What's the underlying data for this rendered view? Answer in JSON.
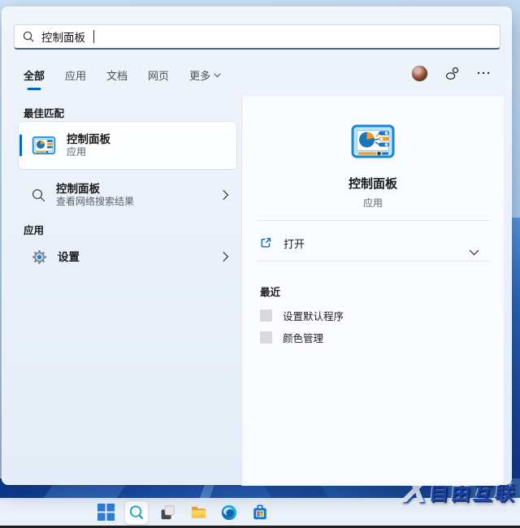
{
  "search": {
    "query": "控制面板"
  },
  "tabs": {
    "items": [
      {
        "label": "全部",
        "active": true
      },
      {
        "label": "应用",
        "active": false
      },
      {
        "label": "文档",
        "active": false
      },
      {
        "label": "网页",
        "active": false
      },
      {
        "label": "更多",
        "active": false,
        "has_chevron": true
      }
    ]
  },
  "header_icons": {
    "more_label": "···"
  },
  "left": {
    "best_match_header": "最佳匹配",
    "best_match": {
      "title": "控制面板",
      "subtitle": "应用"
    },
    "web_suggestion": {
      "title": "控制面板",
      "subtitle": "查看网络搜索结果"
    },
    "apps_header": "应用",
    "settings": {
      "label": "设置"
    }
  },
  "right": {
    "title": "控制面板",
    "subtitle": "应用",
    "open_label": "打开",
    "recent_header": "最近",
    "recent": [
      "设置默认程序",
      "颜色管理"
    ]
  },
  "taskbar": {
    "items": [
      {
        "name": "windows-start"
      },
      {
        "name": "search",
        "active": true
      },
      {
        "name": "task-view"
      },
      {
        "name": "file-explorer"
      },
      {
        "name": "edge"
      },
      {
        "name": "microsoft-store"
      }
    ]
  },
  "watermark": {
    "x": "X",
    "text": "自由互联"
  },
  "colors": {
    "accent": "#0067c0",
    "search_underline": "#44678a",
    "panel_bg": "#e9f0f9",
    "right_pane_bg": "#f9fbfe"
  }
}
